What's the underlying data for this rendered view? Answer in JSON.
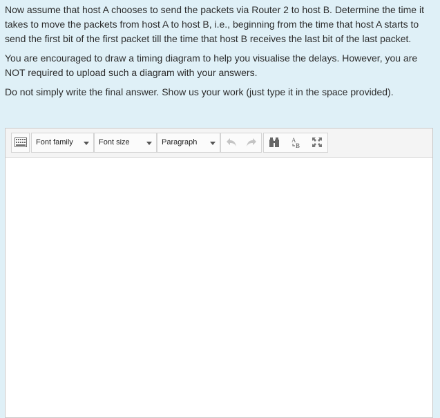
{
  "question": {
    "paragraphs": [
      "Now assume that host A chooses to send the packets via Router 2 to host B.  Determine the time it takes to move the packets from host A to host B, i.e., beginning from the time that host A starts to send the first bit of the first packet till the time that host B receives the last bit of the last packet.",
      "You are encouraged to draw a timing diagram to help you visualise the delays. However, you are NOT required to upload such a diagram with your answers.",
      "Do not simply write the final answer. Show us your work (just type it in the space provided)."
    ]
  },
  "editor": {
    "toolbar": {
      "kitchen_sink_icon": "keyboard-icon",
      "font_family_label": "Font family",
      "font_size_label": "Font size",
      "paragraph_label": "Paragraph",
      "undo_icon": "undo-icon",
      "redo_icon": "redo-icon",
      "find_icon": "binoculars-icon",
      "find_replace_icon": "find-replace-icon",
      "fullscreen_icon": "fullscreen-icon"
    },
    "content": ""
  }
}
